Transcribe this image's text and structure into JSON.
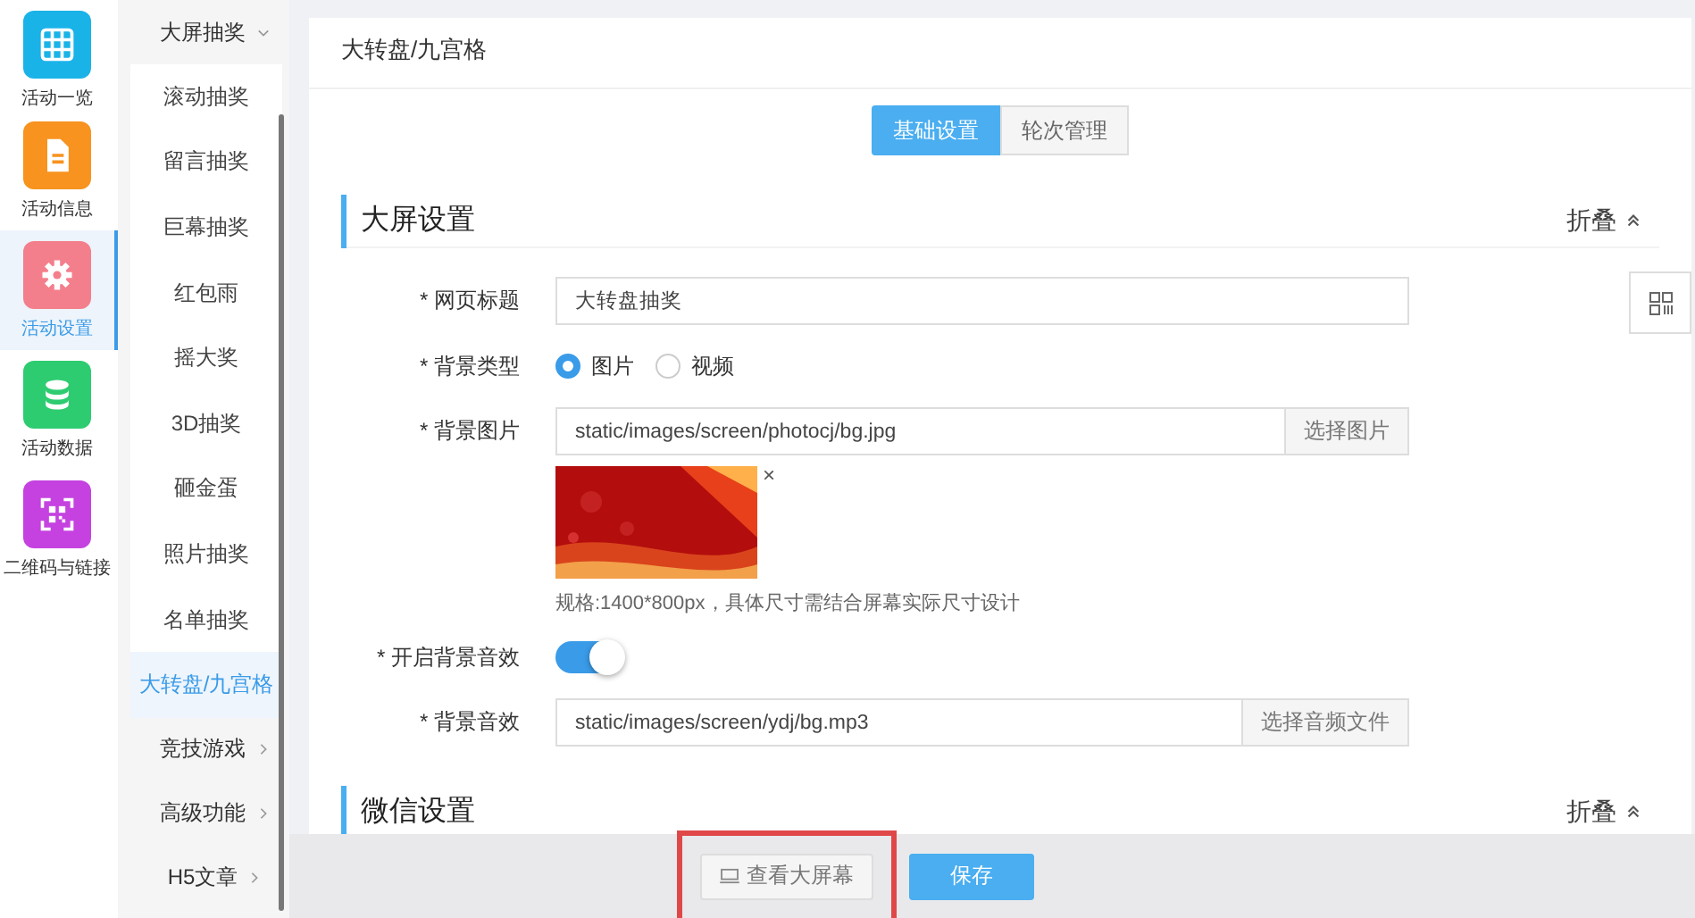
{
  "nav": [
    {
      "label": "活动一览",
      "kind": "grid",
      "color": "#1ab3e8",
      "selected": false
    },
    {
      "label": "活动信息",
      "kind": "doc",
      "color": "#f7931e",
      "selected": false
    },
    {
      "label": "活动设置",
      "kind": "gear",
      "color": "#f47f8c",
      "selected": true
    },
    {
      "label": "活动数据",
      "kind": "db",
      "color": "#2ecc71",
      "selected": false
    },
    {
      "label": "二维码与链接",
      "kind": "qr",
      "color": "#c542e0",
      "selected": false
    }
  ],
  "submenu": [
    {
      "label": "大屏抽奖",
      "expanded": true,
      "children": [
        {
          "label": "滚动抽奖",
          "selected": false
        },
        {
          "label": "留言抽奖",
          "selected": false
        },
        {
          "label": "巨幕抽奖",
          "selected": false
        },
        {
          "label": "红包雨",
          "selected": false
        },
        {
          "label": "摇大奖",
          "selected": false
        },
        {
          "label": "3D抽奖",
          "selected": false
        },
        {
          "label": "砸金蛋",
          "selected": false
        },
        {
          "label": "照片抽奖",
          "selected": false
        },
        {
          "label": "名单抽奖",
          "selected": false
        },
        {
          "label": "大转盘/九宫格",
          "selected": true
        }
      ]
    },
    {
      "label": "竞技游戏",
      "expanded": false
    },
    {
      "label": "高级功能",
      "expanded": false
    },
    {
      "label": "H5文章",
      "expanded": false
    }
  ],
  "page_title": "大转盘/九宫格",
  "tabs": [
    {
      "label": "基础设置",
      "selected": true
    },
    {
      "label": "轮次管理",
      "selected": false
    }
  ],
  "sections": [
    {
      "title": "大屏设置",
      "collapse": "折叠",
      "fields": [
        {
          "kind": "text",
          "label": "* 网页标题",
          "value": "大转盘抽奖"
        },
        {
          "kind": "radio",
          "label": "* 背景类型",
          "options": [
            {
              "label": "图片",
              "selected": true
            },
            {
              "label": "视频",
              "selected": false
            }
          ]
        },
        {
          "kind": "file",
          "label": "* 背景图片",
          "value": "static/images/screen/photocj/bg.jpg",
          "button": "选择图片",
          "preview": {
            "kind": "picture",
            "remove": "×"
          },
          "hint": "规格:1400*800px，具体尺寸需结合屏幕实际尺寸设计"
        },
        {
          "kind": "switch",
          "label": "* 开启背景音效",
          "on": true
        },
        {
          "kind": "file",
          "label": "* 背景音效",
          "value": "static/images/screen/ydj/bg.mp3",
          "button": "选择音频文件"
        }
      ]
    },
    {
      "title": "微信设置",
      "collapse": "折叠"
    }
  ],
  "footer": [
    {
      "label": "查看大屏幕",
      "kind": "preview",
      "highlighted": true
    },
    {
      "label": "保存",
      "kind": "primary",
      "highlighted": false
    }
  ]
}
